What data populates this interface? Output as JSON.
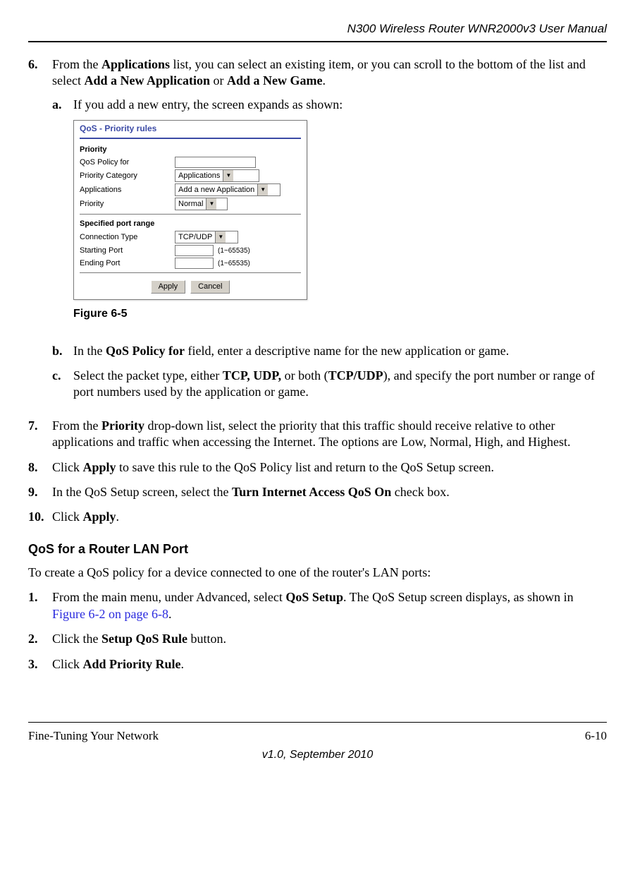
{
  "header": {
    "title": "N300 Wireless Router WNR2000v3 User Manual"
  },
  "steps": {
    "s6_marker": "6.",
    "s6_p1a": "From the ",
    "s6_b1": "Applications",
    "s6_p1b": " list, you can select an existing item, or you can scroll to the bottom of the list and select ",
    "s6_b2": "Add a New Application",
    "s6_p1c": " or ",
    "s6_b3": "Add a New Game",
    "s6_p1d": ".",
    "a_marker": "a.",
    "a_text": "If you add a new entry, the screen expands as shown:",
    "fig_caption": "Figure 6-5",
    "b_marker": "b.",
    "b_pre": "In the ",
    "b_bold": "QoS Policy for",
    "b_post": " field, enter a descriptive name for the new application or game.",
    "c_marker": "c.",
    "c_pre": "Select the packet type, either ",
    "c_b1": "TCP, UDP,",
    "c_mid": " or both (",
    "c_b2": "TCP/UDP",
    "c_post": "), and specify the port number or range of port numbers used by the application or game.",
    "s7_marker": "7.",
    "s7_pre": "From the ",
    "s7_b": "Priority",
    "s7_post": " drop-down list, select the priority that this traffic should receive relative to other applications and traffic when accessing the Internet. The options are Low, Normal, High, and Highest.",
    "s8_marker": "8.",
    "s8_pre": "Click ",
    "s8_b": "Apply",
    "s8_post": " to save this rule to the QoS Policy list and return to the QoS Setup screen.",
    "s9_marker": "9.",
    "s9_pre": "In the QoS Setup screen, select the ",
    "s9_b": "Turn Internet Access QoS On",
    "s9_post": " check box.",
    "s10_marker": "10.",
    "s10_pre": "Click ",
    "s10_b": "Apply",
    "s10_post": "."
  },
  "subhead": "QoS for a Router LAN Port",
  "lan_intro": "To create a QoS policy for a device connected to one of the router's LAN ports:",
  "lan": {
    "l1_marker": "1.",
    "l1_pre": "From the main menu, under Advanced, select ",
    "l1_b": "QoS Setup",
    "l1_mid": ". The QoS Setup screen displays, as shown in ",
    "l1_link": "Figure 6-2 on page 6-8",
    "l1_post": ".",
    "l2_marker": "2.",
    "l2_pre": "Click the ",
    "l2_b": "Setup QoS Rule",
    "l2_post": " button.",
    "l3_marker": "3.",
    "l3_pre": "Click ",
    "l3_b": "Add Priority Rule",
    "l3_post": "."
  },
  "ui": {
    "title": "QoS - Priority rules",
    "priority_heading": "Priority",
    "label_policy": "QoS Policy for",
    "label_category": "Priority Category",
    "sel_category": "Applications",
    "label_applications": "Applications",
    "sel_applications": "Add a new Application",
    "label_priority": "Priority",
    "sel_priority": "Normal",
    "spec_heading": "Specified port range",
    "label_conn": "Connection Type",
    "sel_conn": "TCP/UDP",
    "label_start": "Starting Port",
    "label_end": "Ending Port",
    "range_hint": "(1~65535)",
    "btn_apply": "Apply",
    "btn_cancel": "Cancel"
  },
  "footer": {
    "left": "Fine-Tuning Your Network",
    "right": "6-10",
    "version": "v1.0, September 2010"
  }
}
